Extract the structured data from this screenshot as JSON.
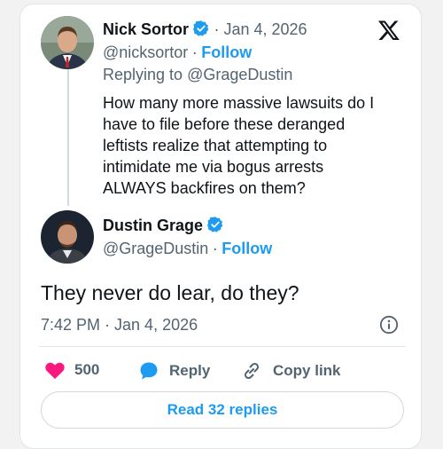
{
  "tweet1": {
    "name": "Nick Sortor",
    "date": "· Jan 4, 2026",
    "handle": "@nicksortor",
    "sep": "·",
    "follow": "Follow",
    "replying_prefix": "Replying to ",
    "replying_handle": "@GrageDustin",
    "lines": [
      "How many more massive lawsuits do I",
      "have to file before these deranged",
      "leftists realize that attempting to",
      "intimidate me via bogus arrests",
      "ALWAYS backfires on them?"
    ]
  },
  "tweet2": {
    "name": "Dustin Grage",
    "handle": "@GrageDustin",
    "sep": "·",
    "follow": "Follow",
    "text": "They never do lear, do they?",
    "timestamp": "7:42 PM · Jan 4, 2026"
  },
  "actions": {
    "likes": "500",
    "reply": "Reply",
    "copy": "Copy link"
  },
  "read_replies": "Read 32 replies",
  "colors": {
    "accent": "#1d9bf0",
    "like": "#f91880",
    "muted": "#536471"
  },
  "icons": [
    "verified-badge-icon",
    "x-logo-icon",
    "info-icon",
    "heart-icon",
    "reply-bubble-icon",
    "link-icon"
  ]
}
